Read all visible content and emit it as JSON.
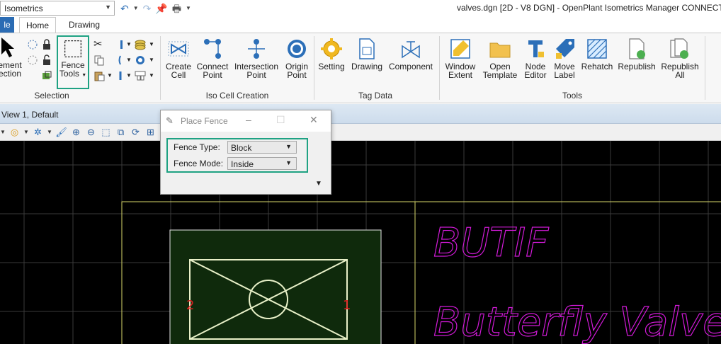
{
  "titlebar": {
    "workflow_value": "Isometrics",
    "window_title": "valves.dgn [2D - V8 DGN] - OpenPlant Isometrics Manager CONNECT E"
  },
  "tabs": {
    "file": "le",
    "home": "Home",
    "drawing": "Drawing"
  },
  "ribbon": {
    "selection": {
      "label": "Selection",
      "element_selection": [
        "ement",
        "ection"
      ],
      "fence_tools": [
        "Fence",
        "Tools"
      ]
    },
    "iso_cell_creation": {
      "label": "Iso Cell Creation",
      "buttons": [
        {
          "l1": "Create",
          "l2": "Cell"
        },
        {
          "l1": "Connect",
          "l2": "Point"
        },
        {
          "l1": "Intersection",
          "l2": "Point"
        },
        {
          "l1": "Origin",
          "l2": "Point"
        }
      ]
    },
    "tag_data": {
      "label": "Tag Data",
      "buttons": [
        {
          "l1": "Setting",
          "l2": ""
        },
        {
          "l1": "Drawing",
          "l2": ""
        },
        {
          "l1": "Component",
          "l2": ""
        }
      ]
    },
    "tools": {
      "label": "Tools",
      "buttons": [
        {
          "l1": "Window",
          "l2": "Extent"
        },
        {
          "l1": "Open",
          "l2": "Template"
        },
        {
          "l1": "Node",
          "l2": "Editor"
        },
        {
          "l1": "Move",
          "l2": "Label"
        },
        {
          "l1": "Rehatch",
          "l2": ""
        },
        {
          "l1": "Republish",
          "l2": ""
        },
        {
          "l1": "Republish",
          "l2": "All"
        }
      ]
    }
  },
  "view": {
    "title": "View 1, Default"
  },
  "dialog": {
    "title": "Place Fence",
    "fence_type_label": "Fence Type:",
    "fence_type_value": "Block",
    "fence_mode_label": "Fence Mode:",
    "fence_mode_value": "Inside"
  },
  "drawing": {
    "text_top": "BUTIF",
    "text_bottom": "Butterfly Valve",
    "node_left": "2",
    "node_right": "1"
  },
  "colors": {
    "accent_highlight": "#1fa283",
    "canvas_bg": "#000000",
    "magenta_text": "#d21ad8",
    "fence_fill": "#0f2a0c",
    "yellow_border": "#d8d86a"
  }
}
